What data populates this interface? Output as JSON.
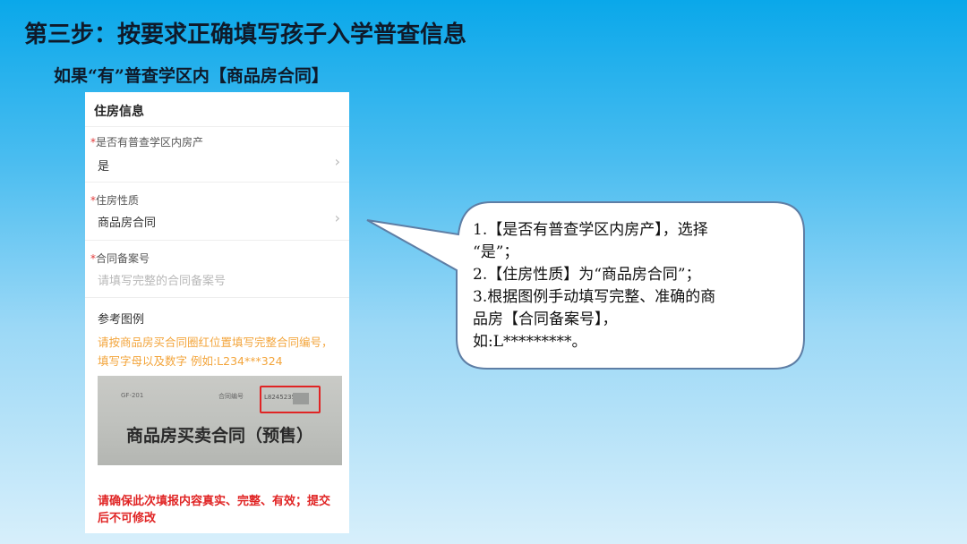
{
  "slide": {
    "title": "第三步：按要求正确填写孩子入学普查信息",
    "subtitle": "如果“有”普查学区内【商品房合同】"
  },
  "form": {
    "section_title": "住房信息",
    "fields": [
      {
        "required_mark": "*",
        "label": "是否有普查学区内房产",
        "value": "是",
        "chevron": "›"
      },
      {
        "required_mark": "*",
        "label": "住房性质",
        "value": "商品房合同",
        "chevron": "›"
      },
      {
        "required_mark": "*",
        "label": "合同备案号",
        "placeholder": "请填写完整的合同备案号"
      }
    ],
    "reference": {
      "label": "参考图例",
      "note": "请按商品房买合同圈红位置填写完整合同编号，填写字母以及数字 例如:L234***324",
      "image": {
        "left_code": "GF-201",
        "contract_no_label": "合同编号",
        "contract_no_value": "L8245235",
        "contract_title": "商品房买卖合同（预售）"
      }
    },
    "warning": "请确保此次填报内容真实、完整、有效；提交后不可修改"
  },
  "callout": {
    "lines": [
      "1.【是否有普查学区内房产】，选择",
      "“是”；",
      "2.【住房性质】为“商品房合同”；",
      "3.根据图例手动填写完整、准确的商",
      "品房【合同备案号】，",
      "如:L*********。"
    ]
  },
  "colors": {
    "accent_orange": "#f3a53c",
    "warning_red": "#e02424",
    "callout_border": "#5e7ea5"
  }
}
